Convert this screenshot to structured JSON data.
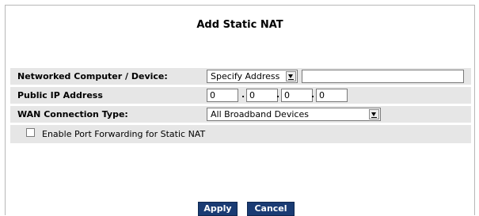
{
  "page_title": "Add Static NAT",
  "rows": {
    "networked_device": {
      "label": "Networked Computer / Device:",
      "select_value": "Specify Address",
      "address_value": ""
    },
    "public_ip": {
      "label": "Public IP Address",
      "octets": [
        "0",
        "0",
        "0",
        "0"
      ],
      "separator": "."
    },
    "wan_type": {
      "label": "WAN Connection Type:",
      "select_value": "All Broadband Devices"
    },
    "port_forwarding": {
      "label": "Enable Port Forwarding for Static NAT",
      "checked": false
    }
  },
  "buttons": {
    "apply": "Apply",
    "cancel": "Cancel"
  },
  "colors": {
    "row_background": "#e6e6e6",
    "button_background": "#1a3b73",
    "button_text": "#ffffff"
  }
}
